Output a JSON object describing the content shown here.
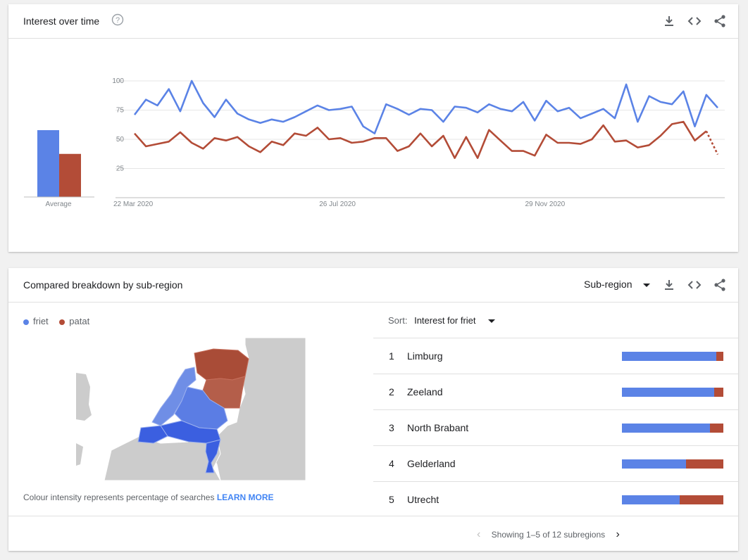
{
  "colors": {
    "friet": "#5b83e6",
    "patat": "#b34c37",
    "friet_map": "#6f8ee6",
    "patat_map": "#a94c37"
  },
  "interest_over_time": {
    "title": "Interest over time",
    "icons": [
      "help-icon",
      "download-icon",
      "embed-icon",
      "share-icon"
    ],
    "average_label": "Average",
    "chart_data": {
      "type": "line",
      "ylim": [
        0,
        100
      ],
      "yticks": [
        "100",
        "75",
        "50",
        "25"
      ],
      "ytick_values": [
        100,
        75,
        50,
        25
      ],
      "xtick_labels": [
        "22 Mar 2020",
        "26 Jul 2020",
        "29 Nov 2020"
      ],
      "xtick_index": [
        0,
        18,
        36
      ],
      "series": [
        {
          "name": "friet",
          "average": 76,
          "values": [
            71,
            84,
            79,
            93,
            74,
            100,
            81,
            69,
            84,
            72,
            67,
            64,
            67,
            65,
            69,
            74,
            79,
            75,
            76,
            78,
            61,
            55,
            80,
            76,
            71,
            76,
            75,
            65,
            78,
            77,
            73,
            80,
            76,
            74,
            82,
            66,
            83,
            74,
            77,
            68,
            72,
            76,
            68,
            97,
            65,
            87,
            82,
            80,
            91,
            61,
            88,
            77
          ]
        },
        {
          "name": "patat",
          "average": 49,
          "values": [
            55,
            44,
            46,
            48,
            56,
            47,
            42,
            51,
            49,
            52,
            44,
            39,
            48,
            45,
            55,
            53,
            60,
            50,
            51,
            47,
            48,
            51,
            51,
            40,
            44,
            55,
            44,
            53,
            34,
            52,
            34,
            58,
            49,
            40,
            40,
            36,
            54,
            47,
            47,
            46,
            50,
            62,
            48,
            49,
            43,
            45,
            53,
            63,
            65,
            49,
            57,
            37
          ],
          "partial_from": 50
        }
      ]
    }
  },
  "breakdown": {
    "title": "Compared breakdown by sub-region",
    "dropdown_label": "Sub-region",
    "legend": [
      {
        "label": "friet"
      },
      {
        "label": "patat"
      }
    ],
    "map_note": "Colour intensity represents percentage of searches",
    "learn_more": "LEARN MORE",
    "sort_label": "Sort:",
    "sort_value": "Interest for friet",
    "rows": [
      {
        "rank": "1",
        "name": "Limburg",
        "friet": 93,
        "patat": 7
      },
      {
        "rank": "2",
        "name": "Zeeland",
        "friet": 91,
        "patat": 9
      },
      {
        "rank": "3",
        "name": "North Brabant",
        "friet": 87,
        "patat": 13
      },
      {
        "rank": "4",
        "name": "Gelderland",
        "friet": 63,
        "patat": 37
      },
      {
        "rank": "5",
        "name": "Utrecht",
        "friet": 57,
        "patat": 43
      }
    ],
    "pagination": "Showing 1–5 of 12 subregions"
  }
}
